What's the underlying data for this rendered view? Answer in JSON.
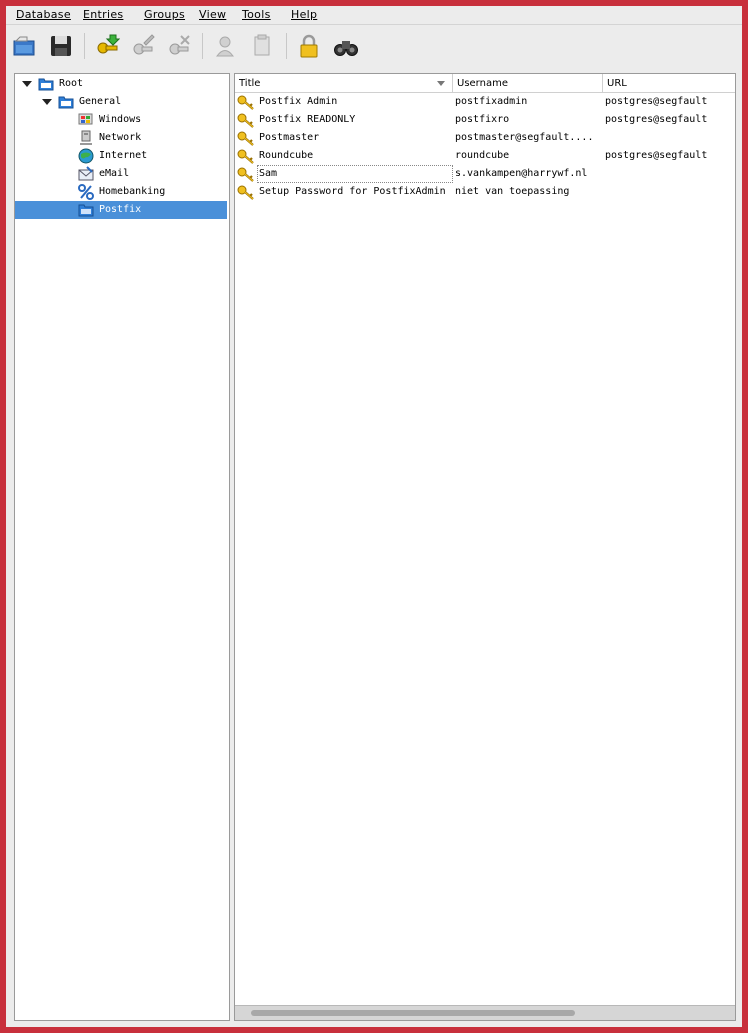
{
  "menubar": {
    "items": [
      {
        "label": "Database"
      },
      {
        "label": "Entries"
      },
      {
        "label": "Groups"
      },
      {
        "label": "View"
      },
      {
        "label": "Tools"
      },
      {
        "label": "Help"
      }
    ]
  },
  "toolbar": {
    "buttons": [
      {
        "icon": "open-database-icon",
        "enabled": true
      },
      {
        "icon": "save-database-icon",
        "enabled": true
      },
      {
        "icon": "add-entry-icon",
        "enabled": true
      },
      {
        "icon": "edit-entry-icon",
        "enabled": false
      },
      {
        "icon": "delete-entry-icon",
        "enabled": false
      },
      {
        "icon": "copy-username-icon",
        "enabled": false
      },
      {
        "icon": "copy-password-icon",
        "enabled": false
      },
      {
        "icon": "lock-workspace-icon",
        "enabled": true
      },
      {
        "icon": "search-icon",
        "enabled": true
      }
    ]
  },
  "tree": {
    "nodes": [
      {
        "label": "Root",
        "icon": "folder-icon",
        "expanded": true
      },
      {
        "label": "General",
        "icon": "folder-icon",
        "expanded": true
      },
      {
        "label": "Windows",
        "icon": "windows-icon"
      },
      {
        "label": "Network",
        "icon": "network-icon"
      },
      {
        "label": "Internet",
        "icon": "internet-icon"
      },
      {
        "label": "eMail",
        "icon": "email-icon"
      },
      {
        "label": "Homebanking",
        "icon": "percent-icon"
      },
      {
        "label": "Postfix",
        "icon": "folder-icon",
        "selected": true
      }
    ]
  },
  "table": {
    "columns": [
      "Title",
      "Username",
      "URL"
    ],
    "rows": [
      {
        "title": "Postfix Admin",
        "username": "postfixadmin",
        "url": "postgres@segfault"
      },
      {
        "title": "Postfix READONLY",
        "username": "postfixro",
        "url": "postgres@segfault"
      },
      {
        "title": "Postmaster",
        "username": "postmaster@segfault....",
        "url": ""
      },
      {
        "title": "Roundcube",
        "username": "roundcube",
        "url": "postgres@segfault"
      },
      {
        "title": "Sam",
        "username": "s.vankampen@harrywf.nl",
        "url": ""
      },
      {
        "title": "Setup Password for PostfixAdmin",
        "username": "niet van toepassing",
        "url": ""
      }
    ]
  },
  "colors": {
    "selection": "#4a90d9",
    "window_border": "#c8303c"
  }
}
